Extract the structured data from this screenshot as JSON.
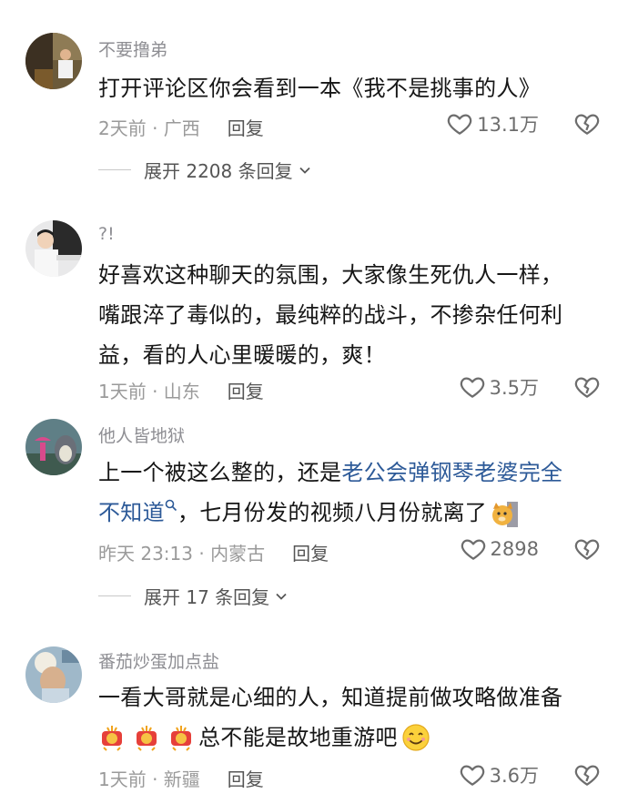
{
  "comments": [
    {
      "username": "不要撸弟",
      "text": "打开评论区你会看到一本《我不是挑事的人》",
      "time_location": "2天前 · 广西",
      "reply_label": "回复",
      "likes": "13.1万",
      "expand": "展开 2208 条回复"
    },
    {
      "username": "?!",
      "text_lines": [
        "好喜欢这种聊天的氛围，大家像生死仇人一样，",
        "嘴跟淬了毒似的，最纯粹的战斗，不掺杂任何利",
        "益，看的人心里暖暖的，爽！"
      ],
      "time_location": "1天前 · 山东",
      "reply_label": "回复",
      "likes": "3.5万"
    },
    {
      "username": "他人皆地狱",
      "text_prefix": "上一个被这么整的，还是",
      "link_line1": "老公会弹钢琴老婆完全",
      "link_line2": "不知道",
      "text_suffix": "，七月份发的视频八月份就离了",
      "time_location": "昨天 23:13 · 内蒙古",
      "reply_label": "回复",
      "likes": "2898",
      "expand": "展开 17 条回复"
    },
    {
      "username": "番茄炒蛋加点盐",
      "text_line1": "一看大哥就是心细的人，知道提前做攻略做准备",
      "text_line2": "总不能是故地重游吧",
      "time_location": "1天前 · 新疆",
      "reply_label": "回复",
      "likes": "3.6万"
    }
  ],
  "icons": {
    "like": "heart-outline-icon",
    "dislike": "broken-heart-icon",
    "expand": "chevron-down-icon",
    "link": "search-icon"
  },
  "colors": {
    "link": "#2d5a98",
    "meta": "#9a9a9a",
    "text": "#161616"
  }
}
